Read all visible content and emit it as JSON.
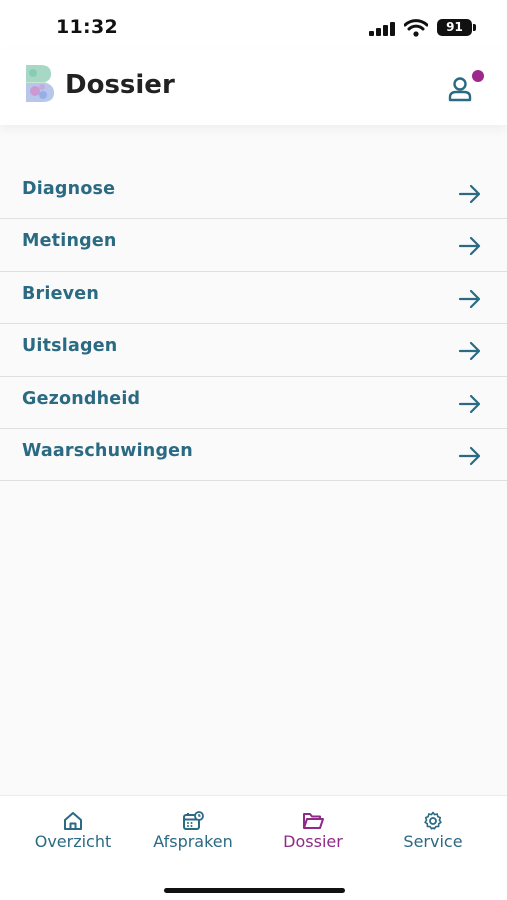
{
  "status_bar": {
    "time": "11:32",
    "battery": "91"
  },
  "header": {
    "title": "Dossier"
  },
  "menu": {
    "items": [
      {
        "label": "Diagnose"
      },
      {
        "label": "Metingen"
      },
      {
        "label": "Brieven"
      },
      {
        "label": "Uitslagen"
      },
      {
        "label": "Gezondheid"
      },
      {
        "label": "Waarschuwingen"
      }
    ]
  },
  "tabs": [
    {
      "label": "Overzicht",
      "icon": "home-icon"
    },
    {
      "label": "Afspraken",
      "icon": "calendar-icon"
    },
    {
      "label": "Dossier",
      "icon": "folder-icon",
      "active": true
    },
    {
      "label": "Service",
      "icon": "gear-icon"
    }
  ],
  "colors": {
    "accent": "#2a6a82",
    "active_tab": "#8e2b86",
    "notification_dot": "#9c2a8a"
  }
}
